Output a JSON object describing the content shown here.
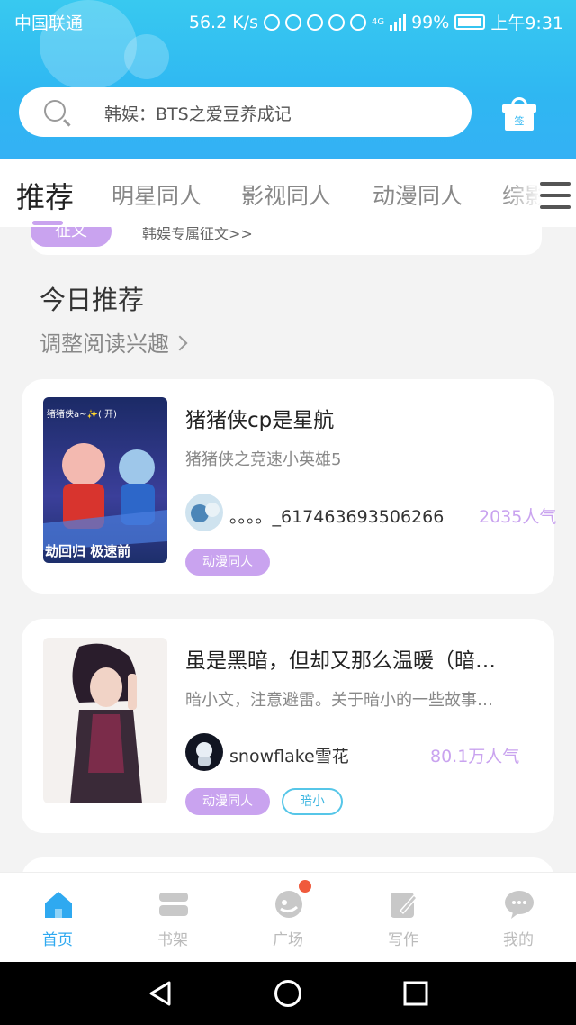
{
  "status_bar": {
    "carrier": "中国联通",
    "speed": "56.2 K/s",
    "network": "4G",
    "battery": "99%",
    "time": "上午9:31"
  },
  "search": {
    "placeholder": "韩娱：BTS之爱豆养成记"
  },
  "gift": {
    "label": "签"
  },
  "tabs": [
    "推荐",
    "明星同人",
    "影视同人",
    "动漫同人",
    "综影"
  ],
  "banner": {
    "tag": "征文",
    "link": "韩娱专属征文>>"
  },
  "section": {
    "title": "今日推荐",
    "interest_link": "调整阅读兴趣"
  },
  "books": [
    {
      "title": "猪猪侠cp是星航",
      "subtitle": "猪猪侠之竞速小英雄5",
      "author": "。。。。_617463693506266",
      "popularity": "2035人气",
      "tags": [
        "动漫同人"
      ],
      "cover_text": "劫回归 极速前",
      "cover_top_text": "猪猪侠a~✨( 开)"
    },
    {
      "title": "虽是黑暗，但却又那么温暖（暗…",
      "subtitle": "暗小文，注意避雷。关于暗小的一些故事…",
      "author": "snowflake雪花",
      "popularity": "80.1万人气",
      "tags": [
        "动漫同人",
        "暗小"
      ]
    }
  ],
  "bottom_nav": [
    {
      "label": "首页",
      "icon": "home-icon",
      "active": true
    },
    {
      "label": "书架",
      "icon": "bookshelf-icon",
      "active": false
    },
    {
      "label": "广场",
      "icon": "square-icon",
      "active": false
    },
    {
      "label": "写作",
      "icon": "write-icon",
      "active": false
    },
    {
      "label": "我的",
      "icon": "profile-icon",
      "active": false
    }
  ],
  "colors": {
    "header": "#2fb7f2",
    "accent_purple": "#c9a3ef",
    "active_nav": "#2fa9f0",
    "badge": "#f05a3c"
  }
}
